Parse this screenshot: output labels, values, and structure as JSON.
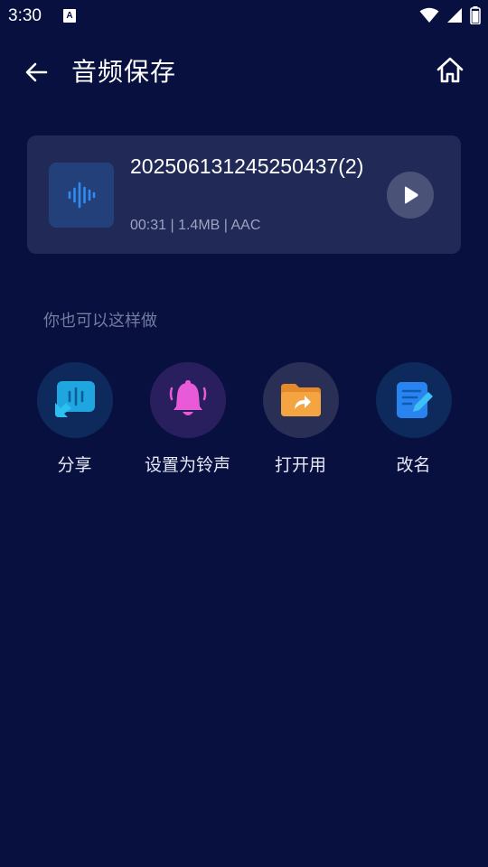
{
  "status_bar": {
    "time": "3:30",
    "notification_icon_letter": "A",
    "icons": [
      "wifi-icon",
      "signal-icon",
      "battery-icon"
    ]
  },
  "header": {
    "title": "音频保存",
    "back_icon": "arrow-left-icon",
    "home_icon": "home-icon"
  },
  "audio_file": {
    "name": "202506131245250437(2)",
    "duration": "00:31",
    "size": "1.4MB",
    "format": "AAC",
    "meta": "00:31 | 1.4MB | AAC",
    "thumb_icon": "waveform-icon",
    "play_icon": "play-icon"
  },
  "suggestions": {
    "label": "你也可以这样做",
    "actions": [
      {
        "label": "分享",
        "icon": "share-icon",
        "color": "#1fa6e0",
        "bg": "#0e2a5c"
      },
      {
        "label": "设置为铃声",
        "icon": "bell-icon",
        "color": "#e85ad8",
        "bg": "#2a1f5e"
      },
      {
        "label": "打开用",
        "icon": "folder-open-icon",
        "color": "#f5a442",
        "bg": "#2a2f55"
      },
      {
        "label": "改名",
        "icon": "rename-icon",
        "color": "#2a84f0",
        "bg": "#0e2a5c"
      }
    ]
  },
  "colors": {
    "background": "#08103f",
    "card": "#212a56",
    "meta_text": "#9ea3c3",
    "section_label": "#747aa0"
  }
}
